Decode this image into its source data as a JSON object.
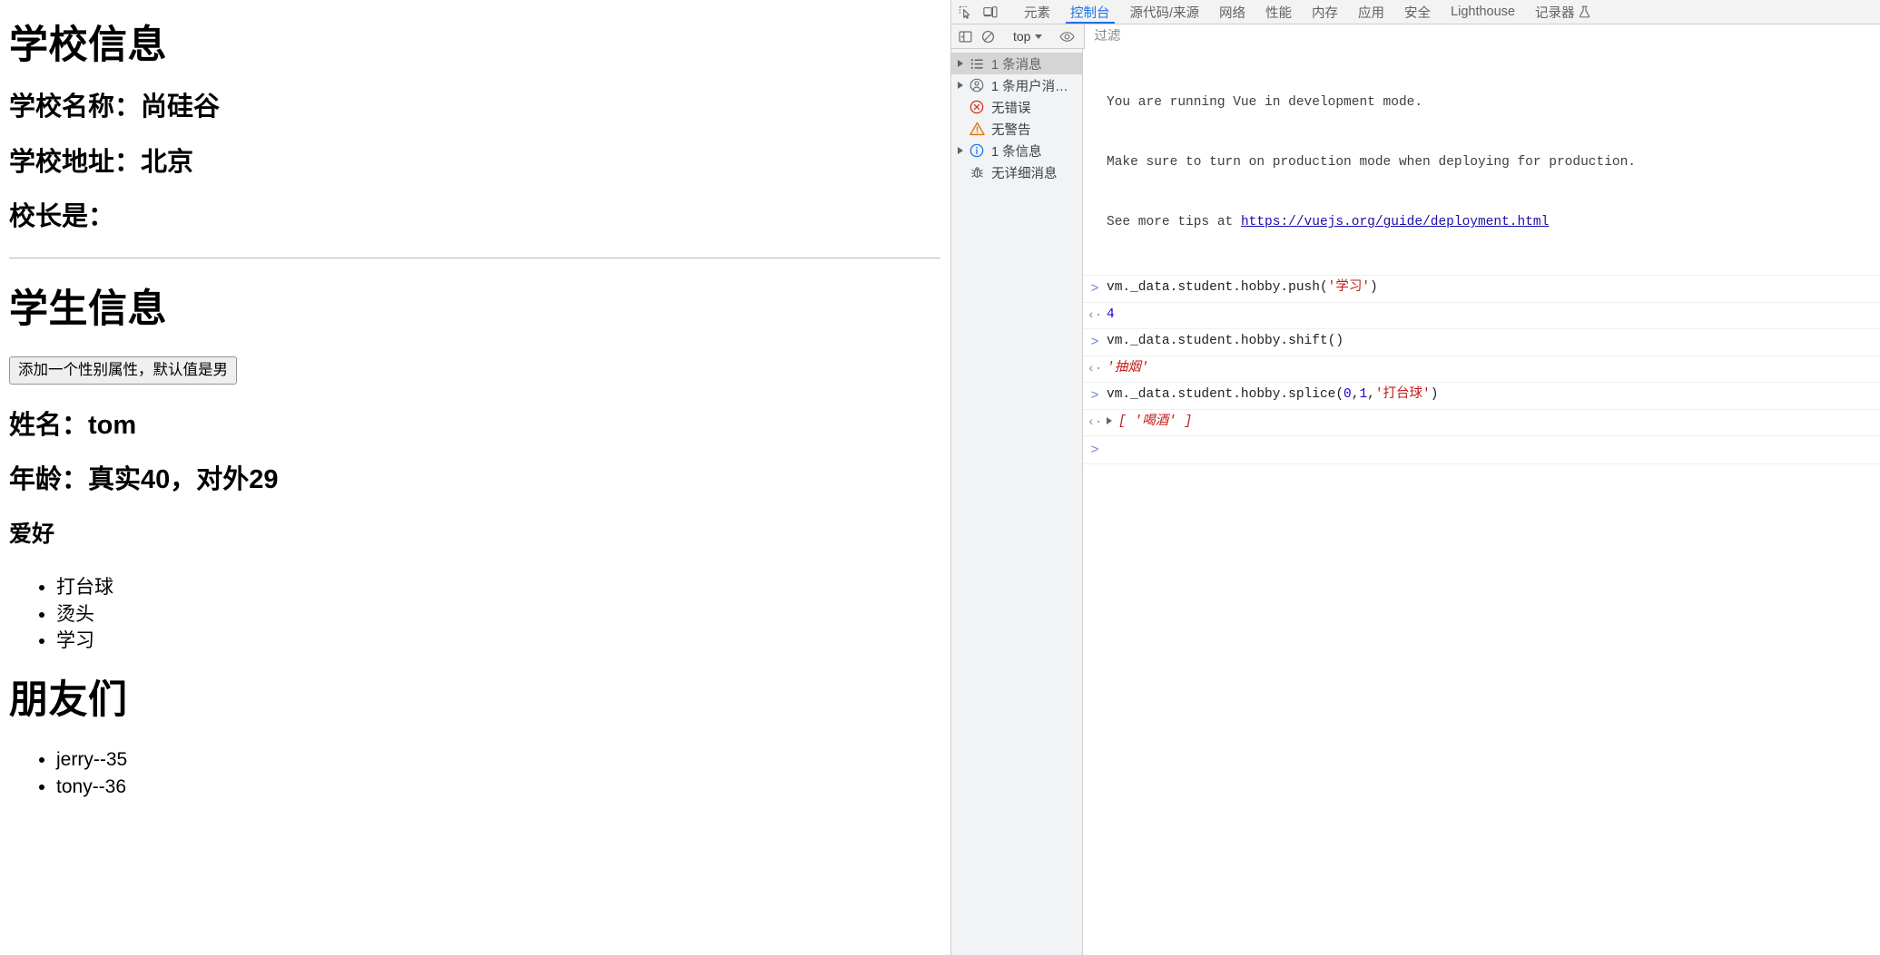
{
  "page": {
    "school_heading": "学校信息",
    "school_name_line": "学校名称：尚硅谷",
    "school_address_line": "学校地址：北京",
    "principal_line": "校长是：",
    "student_heading": "学生信息",
    "add_gender_button": "添加一个性别属性，默认值是男",
    "name_line": "姓名：tom",
    "age_line": "年龄：真实40，对外29",
    "hobby_heading": "爱好",
    "hobbies": [
      "打台球",
      "烫头",
      "学习"
    ],
    "friends_heading": "朋友们",
    "friends": [
      "jerry--35",
      "tony--36"
    ]
  },
  "devtools": {
    "toolbar_icons": [
      {
        "name": "inspect-element-icon"
      },
      {
        "name": "device-toolbar-icon"
      }
    ],
    "tabs": [
      {
        "label": "元素",
        "active": false
      },
      {
        "label": "控制台",
        "active": true
      },
      {
        "label": "源代码/来源",
        "active": false
      },
      {
        "label": "网络",
        "active": false
      },
      {
        "label": "性能",
        "active": false
      },
      {
        "label": "内存",
        "active": false
      },
      {
        "label": "应用",
        "active": false
      },
      {
        "label": "安全",
        "active": false
      },
      {
        "label": "Lighthouse",
        "active": false
      },
      {
        "label": "记录器",
        "active": false,
        "flask": true
      }
    ],
    "console_toolbar": {
      "sidebar_toggle_icon": "sidebar-toggle-icon",
      "clear_console_icon": "clear-console-icon",
      "context": "top",
      "live_expression_icon": "eye-icon",
      "filter_placeholder": "过滤",
      "filter_value": ""
    },
    "sidebar": [
      {
        "label": "1 条消息",
        "icon": "list-icon",
        "expandable": true,
        "selected": true
      },
      {
        "label": "1 条用户消…",
        "icon": "user-icon",
        "expandable": true,
        "selected": false
      },
      {
        "label": "无错误",
        "icon": "error-icon",
        "expandable": false,
        "selected": false
      },
      {
        "label": "无警告",
        "icon": "warning-icon",
        "expandable": false,
        "selected": false
      },
      {
        "label": "1 条信息",
        "icon": "info-icon",
        "expandable": true,
        "selected": false
      },
      {
        "label": "无详细消息",
        "icon": "verbose-bug-icon",
        "expandable": false,
        "selected": false
      }
    ],
    "console": {
      "vue_message": {
        "line1": "You are running Vue in development mode.",
        "line2": "Make sure to turn on production mode when deploying for production.",
        "line3_prefix": "See more tips at ",
        "link": "https://vuejs.org/guide/deployment.html"
      },
      "entries": [
        {
          "input_parts": [
            {
              "t": "vm._data.student.hobby.push(",
              "c": "plain"
            },
            {
              "t": "'学习'",
              "c": "str"
            },
            {
              "t": ")",
              "c": "plain"
            }
          ],
          "output": {
            "text": "4",
            "kind": "num"
          }
        },
        {
          "input_parts": [
            {
              "t": "vm._data.student.hobby.shift()",
              "c": "plain"
            }
          ],
          "output": {
            "text": "'抽烟'",
            "kind": "str"
          }
        },
        {
          "input_parts": [
            {
              "t": "vm._data.student.hobby.splice(",
              "c": "plain"
            },
            {
              "t": "0",
              "c": "num"
            },
            {
              "t": ",",
              "c": "plain"
            },
            {
              "t": "1",
              "c": "num"
            },
            {
              "t": ",",
              "c": "plain"
            },
            {
              "t": "'打台球'",
              "c": "str"
            },
            {
              "t": ")",
              "c": "plain"
            }
          ],
          "output": {
            "text": "[ '喝酒' ]",
            "kind": "arr"
          }
        }
      ],
      "prompt_symbol": ">"
    }
  },
  "colors": {
    "accent_blue": "#1a73e8",
    "string_red": "#c41a16",
    "number_blue": "#1c00cf",
    "link_blue": "#1a0dab",
    "error_red": "#d93025",
    "warning_orange": "#e37400",
    "info_blue": "#1a73e8"
  }
}
